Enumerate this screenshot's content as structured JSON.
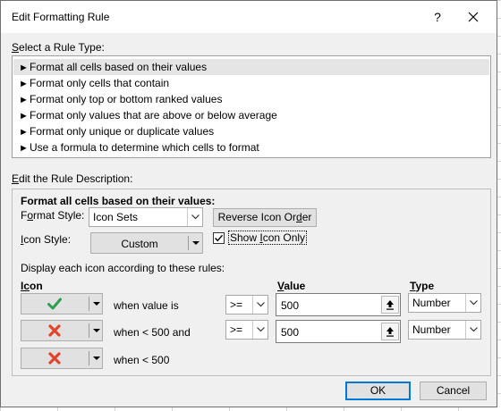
{
  "dialog": {
    "title": "Edit Formatting Rule",
    "help_label": "?",
    "close_label": "✕"
  },
  "rule_type": {
    "label_u": "S",
    "label_rest": "elect a Rule Type:",
    "items": [
      {
        "label": "Format all cells based on their values",
        "selected": true
      },
      {
        "label": "Format only cells that contain",
        "selected": false
      },
      {
        "label": "Format only top or bottom ranked values",
        "selected": false
      },
      {
        "label": "Format only values that are above or below average",
        "selected": false
      },
      {
        "label": "Format only unique or duplicate values",
        "selected": false
      },
      {
        "label": "Use a formula to determine which cells to format",
        "selected": false
      }
    ]
  },
  "description": {
    "label_u": "E",
    "label_rest": "dit the Rule Description:",
    "heading": "Format all cells based on their values:",
    "format_style_label_pre": "F",
    "format_style_label_u": "o",
    "format_style_label_post": "rmat Style:",
    "format_style_value": "Icon Sets",
    "reverse_btn_pre": "Reverse Icon Or",
    "reverse_btn_u": "d",
    "reverse_btn_post": "er",
    "icon_style_label_pre": "",
    "icon_style_label_u": "I",
    "icon_style_label_post": "con Style:",
    "icon_style_value": "Custom",
    "show_icon_only_pre": "Show ",
    "show_icon_only_u": "I",
    "show_icon_only_post": "con Only",
    "show_icon_only_checked": true,
    "rules_intro": "Display each icon according to these rules:",
    "col_icon_u": "Ic",
    "col_icon_rest": "on",
    "col_value_u": "V",
    "col_value_rest": "alue",
    "col_type_u": "T",
    "col_type_rest": "ype",
    "rows": [
      {
        "icon": "green-check-icon",
        "text": "when value is",
        "operator": ">=",
        "value": "500",
        "type": "Number"
      },
      {
        "icon": "red-x-icon",
        "text": "when < 500 and",
        "operator": ">=",
        "value": "500",
        "type": "Number"
      },
      {
        "icon": "red-x-icon",
        "text": "when < 500"
      }
    ],
    "colors": {
      "check": "#2e9e4f",
      "cross": "#e0452b"
    }
  },
  "footer": {
    "ok_label": "OK",
    "cancel_label": "Cancel"
  }
}
